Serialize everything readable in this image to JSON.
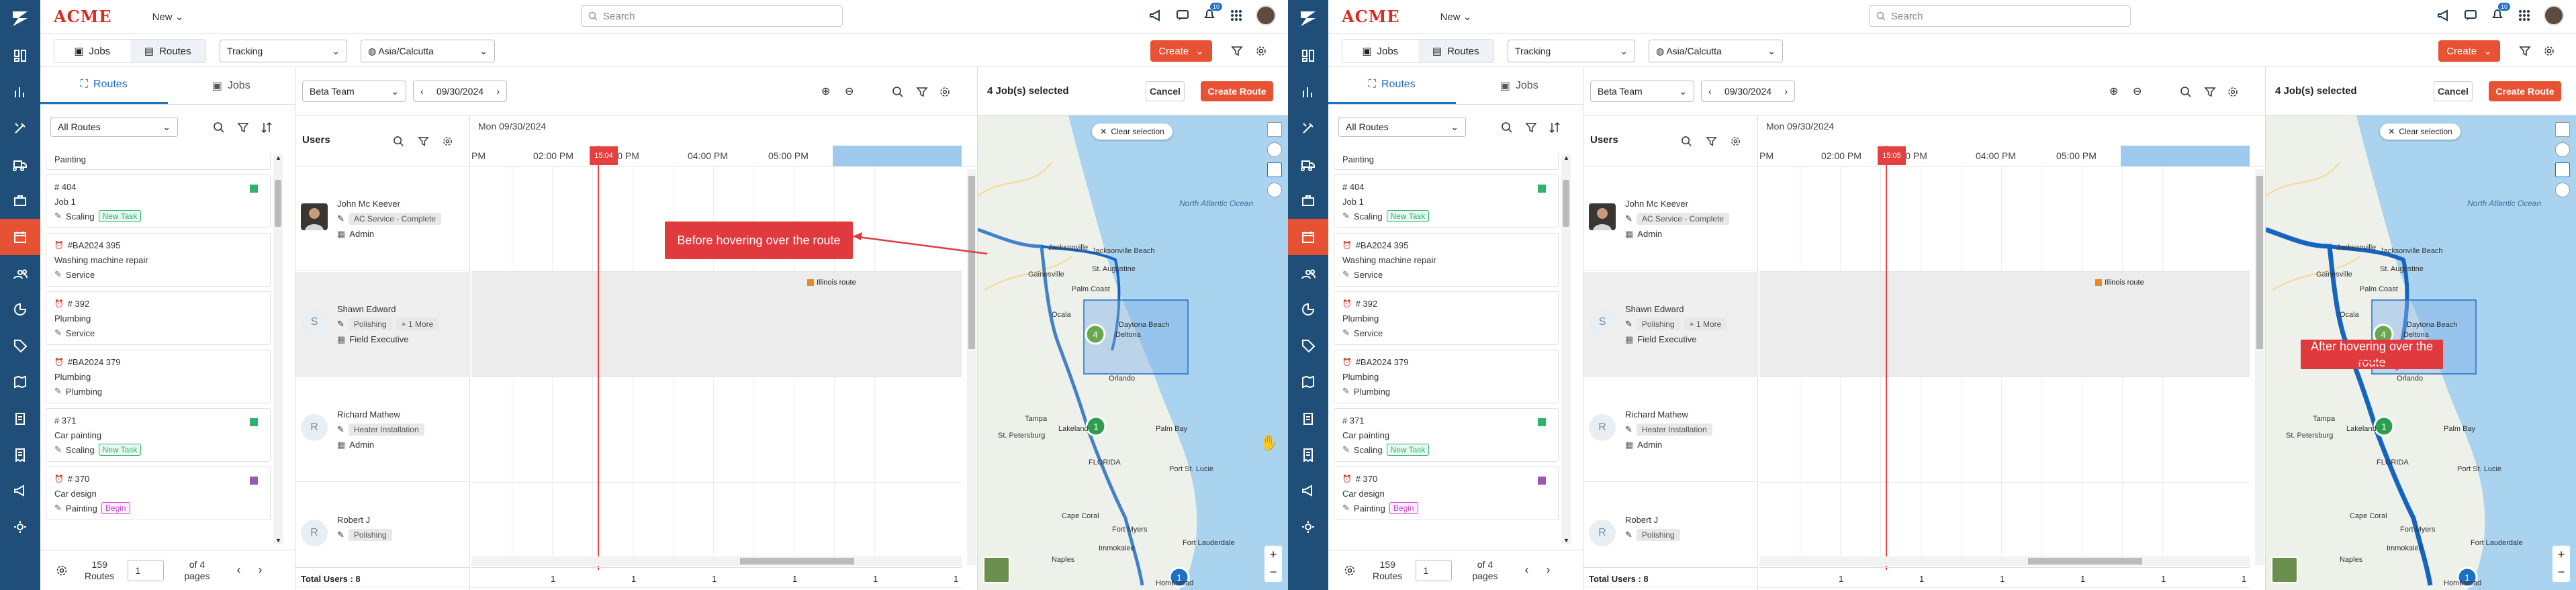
{
  "app": {
    "brand": "ACME",
    "new_menu": "New",
    "search_placeholder": "Search",
    "notification_count": "10"
  },
  "toolbar": {
    "jobs_label": "Jobs",
    "routes_label": "Routes",
    "view_select": "Tracking",
    "timezone": "Asia/Calcutta",
    "create_label": "Create"
  },
  "left": {
    "tab_routes": "Routes",
    "tab_jobs": "Jobs",
    "filter_select": "All Routes",
    "jobs": [
      {
        "id": "",
        "title": "Painting",
        "type": "",
        "tag": "",
        "square": "",
        "partial": true
      },
      {
        "id": "# 404",
        "title": "Job 1",
        "type": "Scaling",
        "tag": "New Task",
        "tag_kind": "new",
        "square": "#2fb36c",
        "alarm": false
      },
      {
        "id": "#BA2024 395",
        "title": "Washing machine repair",
        "type": "Service",
        "tag": "",
        "square": "",
        "alarm": true
      },
      {
        "id": "# 392",
        "title": "Plumbing",
        "type": "Service",
        "tag": "",
        "square": "",
        "alarm": true
      },
      {
        "id": "#BA2024 379",
        "title": "Plumbing",
        "type": "Plumbing",
        "tag": "",
        "square": "",
        "alarm": true
      },
      {
        "id": "# 371",
        "title": "Car painting",
        "type": "Scaling",
        "tag": "New Task",
        "tag_kind": "new",
        "square": "#2fb36c",
        "alarm": false
      },
      {
        "id": "# 370",
        "title": "Car design",
        "type": "Painting",
        "tag": "Begin",
        "tag_kind": "begin",
        "square": "#9b59b6",
        "alarm": true
      }
    ],
    "footer": {
      "routes_count": "159",
      "routes_word": "Routes",
      "page": "1",
      "of_pages": "of 4",
      "pages_word": "pages"
    }
  },
  "schedule": {
    "team": "Beta Team",
    "date": "09/30/2024",
    "users_title": "Users",
    "day_label": "Mon 09/30/2024",
    "time_labels": [
      "PM",
      "02:00 PM",
      "03:00 PM",
      "04:00 PM",
      "05:00 PM"
    ],
    "total_users": "Total Users : 8",
    "footer_counts": [
      "1",
      "1",
      "1",
      "1",
      "1",
      "1",
      "1",
      "1",
      "1"
    ],
    "route_label": "Illinois route",
    "users": [
      {
        "name": "John Mc Keever",
        "skill": "AC Service - Complete",
        "more": "",
        "role": "Admin",
        "initial": "",
        "photo": true
      },
      {
        "name": "Shawn Edward",
        "skill": "Polishing",
        "more": "+ 1 More",
        "role": "Field Executive",
        "initial": "S",
        "photo": false
      },
      {
        "name": "Richard Mathew",
        "skill": "Heater Installation",
        "more": "",
        "role": "Admin",
        "initial": "R",
        "photo": false
      },
      {
        "name": "Robert J",
        "skill": "Polishing",
        "more": "",
        "role": "",
        "initial": "R",
        "photo": false
      }
    ]
  },
  "map": {
    "selected": "4 Job(s) selected",
    "cancel": "Cancel",
    "create_route": "Create Route",
    "clear_selection": "Clear selection",
    "labels": [
      "Jacksonville",
      "Jacksonville Beach",
      "St. Augustine",
      "Palm Coast",
      "Gainesville",
      "Ocala",
      "Daytona Beach",
      "Deltona",
      "Orlando",
      "Tampa",
      "St. Petersburg",
      "Lakeland",
      "Palm Bay",
      "Port St. Lucie",
      "Fort Myers",
      "Cape Coral",
      "Naples",
      "Immokalee",
      "Fort Lauderdale",
      "Homestead",
      "FLORIDA",
      "North Atlantic Ocean"
    ],
    "cluster_green": "1",
    "cluster_blue": "1",
    "cluster_selected": "4"
  },
  "panes": [
    {
      "time_badge": "15:04",
      "callout": "Before hovering over the route"
    },
    {
      "time_badge": "15:05",
      "callout": "After hovering over the route"
    }
  ],
  "colors": {
    "rail": "#1f4f79",
    "accent": "#e85234",
    "brand": "#d62d20",
    "route": "#1565c0",
    "callout": "#e0393e"
  }
}
